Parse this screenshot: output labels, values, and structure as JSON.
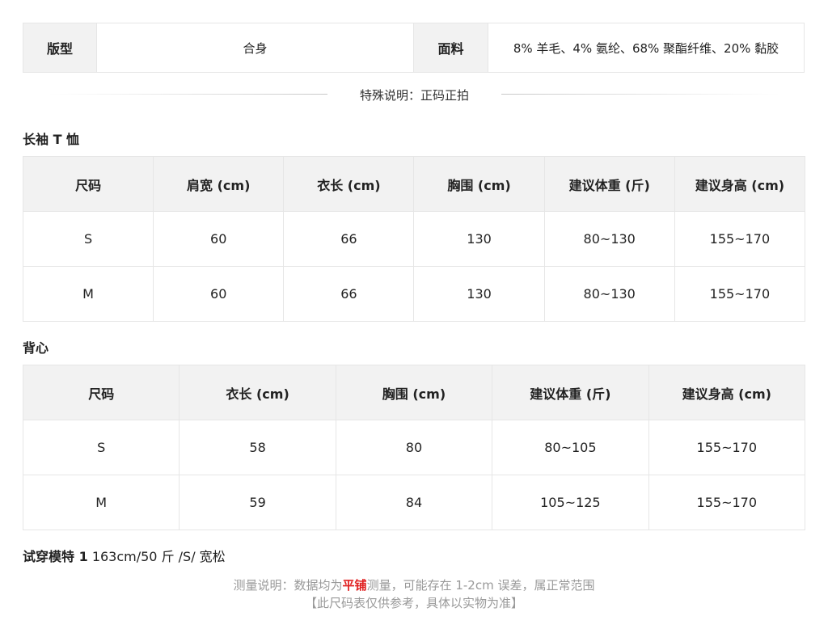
{
  "specs": {
    "fit_label": "版型",
    "fit_value": "合身",
    "fabric_label": "面料",
    "fabric_value": "8% 羊毛、4% 氨纶、68% 聚酯纤维、20% 黏胶"
  },
  "special_note": "特殊说明：正码正拍",
  "longsleeve": {
    "title": "长袖 T 恤",
    "headers": [
      "尺码",
      "肩宽 (cm)",
      "衣长 (cm)",
      "胸围 (cm)",
      "建议体重 (斤)",
      "建议身高 (cm)"
    ],
    "rows": [
      [
        "S",
        "60",
        "66",
        "130",
        "80~130",
        "155~170"
      ],
      [
        "M",
        "60",
        "66",
        "130",
        "80~130",
        "155~170"
      ]
    ]
  },
  "vest": {
    "title": "背心",
    "headers": [
      "尺码",
      "衣长 (cm)",
      "胸围 (cm)",
      "建议体重 (斤)",
      "建议身高 (cm)"
    ],
    "rows": [
      [
        "S",
        "58",
        "80",
        "80~105",
        "155~170"
      ],
      [
        "M",
        "59",
        "84",
        "105~125",
        "155~170"
      ]
    ]
  },
  "model": {
    "label": "试穿模特 1",
    "value": "163cm/50 斤 /S/ 宽松"
  },
  "footer": {
    "line1_prefix": "测量说明：数据均为",
    "line1_highlight": "平铺",
    "line1_suffix": "测量，可能存在 1-2cm 误差，属正常范围",
    "line2": "【此尺码表仅供参考，具体以实物为准】"
  },
  "colors": {
    "header_bg": "#f2f2f2",
    "border": "#e6e6e6",
    "highlight": "#e02020",
    "footer_text": "#999999"
  }
}
